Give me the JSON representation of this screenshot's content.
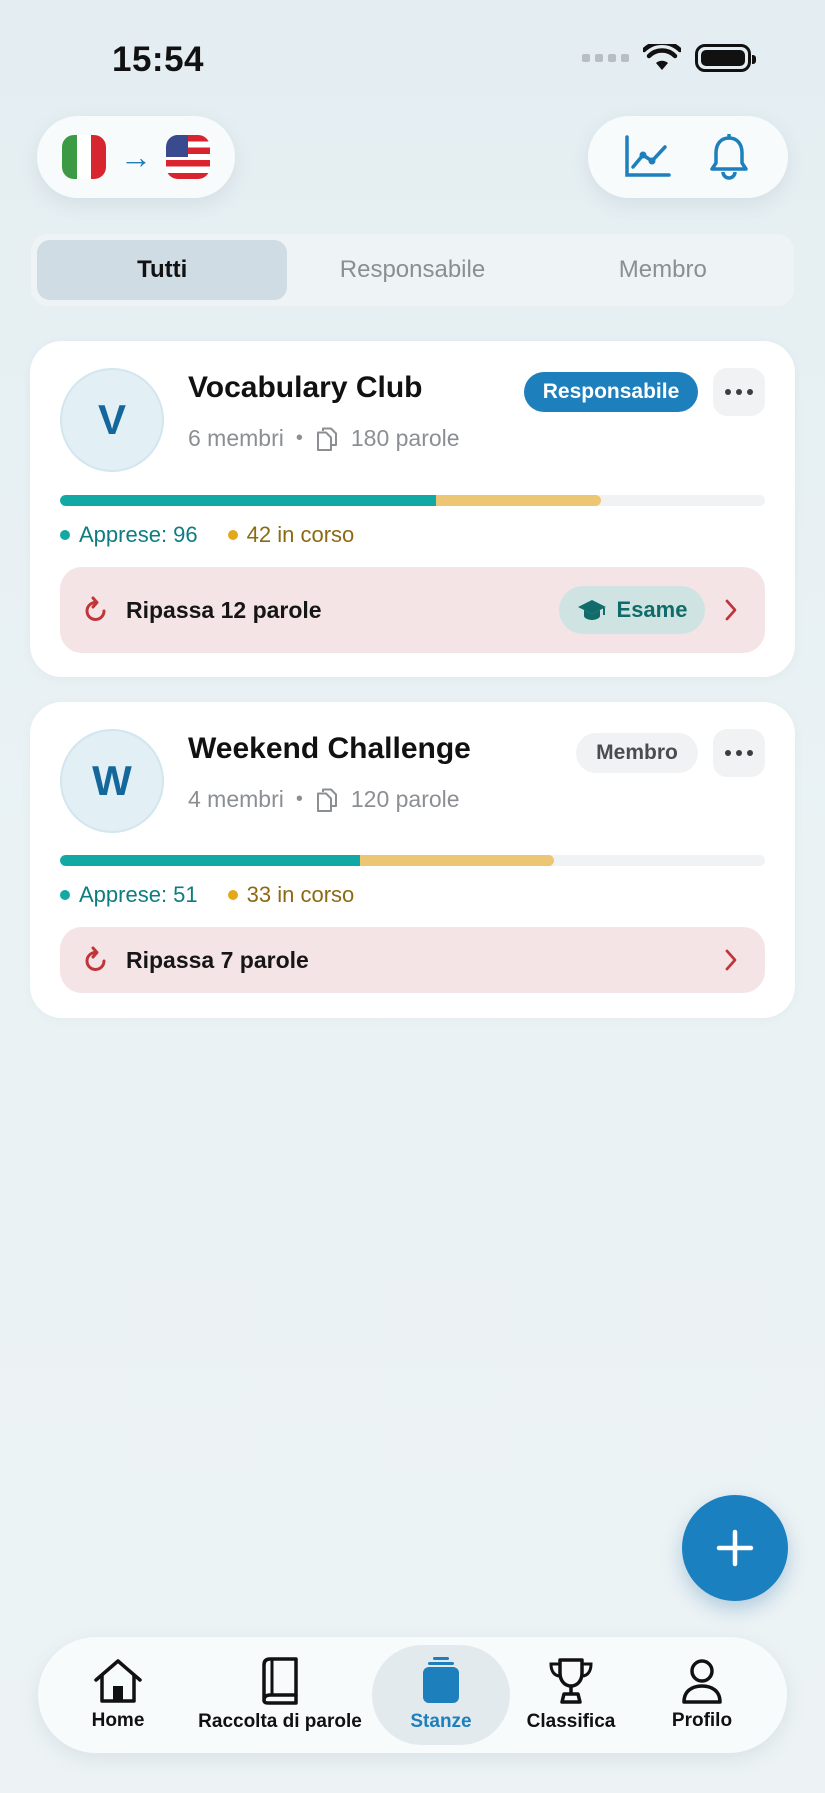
{
  "status_bar": {
    "time": "15:54"
  },
  "language": {
    "from_icon": "italy-flag-icon",
    "to_icon": "us-flag-icon",
    "arrow": "→"
  },
  "header_actions": [
    "stats-chart-icon",
    "bell-icon"
  ],
  "filter_tabs": [
    {
      "label": "Tutti",
      "active": true
    },
    {
      "label": "Responsabile",
      "active": false
    },
    {
      "label": "Membro",
      "active": false
    }
  ],
  "rooms": [
    {
      "initial": "V",
      "name": "Vocabulary Club",
      "members": "6 membri",
      "words": "180 parole",
      "role": "Responsabile",
      "learned_label": "Apprese: 96",
      "in_progress_label": "42 in corso",
      "learned": 96,
      "in_progress": 42,
      "total": 180,
      "review_label": "Ripassa 12 parole",
      "exam_label": "Esame"
    },
    {
      "initial": "W",
      "name": "Weekend Challenge",
      "members": "4 membri",
      "words": "120 parole",
      "role": "Membro",
      "learned_label": "Apprese: 51",
      "in_progress_label": "33 in corso",
      "learned": 51,
      "in_progress": 33,
      "total": 120,
      "review_label": "Ripassa 7 parole"
    }
  ],
  "fab": {
    "icon": "plus-icon"
  },
  "tab_bar": [
    {
      "label": "Home",
      "icon": "home-icon"
    },
    {
      "label": "Raccolta di parole",
      "icon": "book-icon"
    },
    {
      "label": "Stanze",
      "icon": "rooms-icon",
      "active": true
    },
    {
      "label": "Classifica",
      "icon": "trophy-icon"
    },
    {
      "label": "Profilo",
      "icon": "person-icon"
    }
  ],
  "colors": {
    "accent": "#1e7fbd",
    "learned": "#12a9a5",
    "in_progress": "#ecc672",
    "review_bg": "#f5e4e5"
  }
}
